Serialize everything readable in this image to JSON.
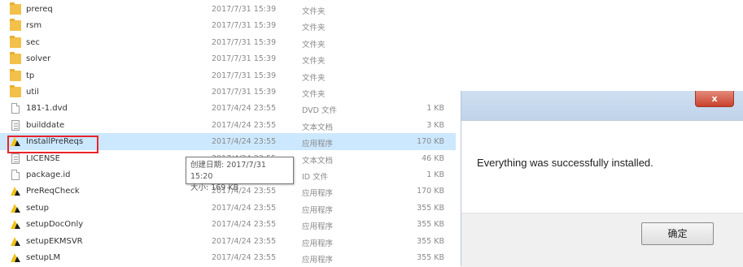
{
  "files": [
    {
      "name": "prereq",
      "date": "2017/7/31 15:39",
      "type": "文件夹",
      "size": "",
      "icon": "folder-icon"
    },
    {
      "name": "rsm",
      "date": "2017/7/31 15:39",
      "type": "文件夹",
      "size": "",
      "icon": "folder-icon"
    },
    {
      "name": "sec",
      "date": "2017/7/31 15:39",
      "type": "文件夹",
      "size": "",
      "icon": "folder-icon"
    },
    {
      "name": "solver",
      "date": "2017/7/31 15:39",
      "type": "文件夹",
      "size": "",
      "icon": "folder-icon"
    },
    {
      "name": "tp",
      "date": "2017/7/31 15:39",
      "type": "文件夹",
      "size": "",
      "icon": "folder-icon"
    },
    {
      "name": "util",
      "date": "2017/7/31 15:39",
      "type": "文件夹",
      "size": "",
      "icon": "folder-icon"
    },
    {
      "name": "181-1.dvd",
      "date": "2017/4/24 23:55",
      "type": "DVD 文件",
      "size": "1 KB",
      "icon": "document-icon"
    },
    {
      "name": "builddate",
      "date": "2017/4/24 23:55",
      "type": "文本文档",
      "size": "3 KB",
      "icon": "text-file-icon"
    },
    {
      "name": "InstallPreReqs",
      "date": "2017/4/24 23:55",
      "type": "应用程序",
      "size": "170 KB",
      "icon": "application-icon"
    },
    {
      "name": "LICENSE",
      "date": "2017/4/24 23:55",
      "type": "文本文档",
      "size": "46 KB",
      "icon": "text-file-icon"
    },
    {
      "name": "package.id",
      "date": "2017/4/24 23:55",
      "type": "ID 文件",
      "size": "1 KB",
      "icon": "document-icon"
    },
    {
      "name": "PreReqCheck",
      "date": "2017/4/24 23:55",
      "type": "应用程序",
      "size": "170 KB",
      "icon": "application-icon"
    },
    {
      "name": "setup",
      "date": "2017/4/24 23:55",
      "type": "应用程序",
      "size": "355 KB",
      "icon": "application-icon"
    },
    {
      "name": "setupDocOnly",
      "date": "2017/4/24 23:55",
      "type": "应用程序",
      "size": "355 KB",
      "icon": "application-icon"
    },
    {
      "name": "setupEKMSVR",
      "date": "2017/4/24 23:55",
      "type": "应用程序",
      "size": "355 KB",
      "icon": "application-icon"
    },
    {
      "name": "setupLM",
      "date": "2017/4/24 23:55",
      "type": "应用程序",
      "size": "355 KB",
      "icon": "application-icon"
    }
  ],
  "selected_file": "InstallPreReqs",
  "tooltip": {
    "created": "创建日期: 2017/7/31 15:20",
    "size": "大小: 169 KB"
  },
  "dialog": {
    "close_label": "x",
    "message": "Everything was successfully installed.",
    "ok_label": "确定"
  },
  "colors": {
    "selection": "#cce8ff",
    "highlight_border": "#e8242b",
    "folder": "#f3c04a",
    "close_button": "#c9422c"
  }
}
